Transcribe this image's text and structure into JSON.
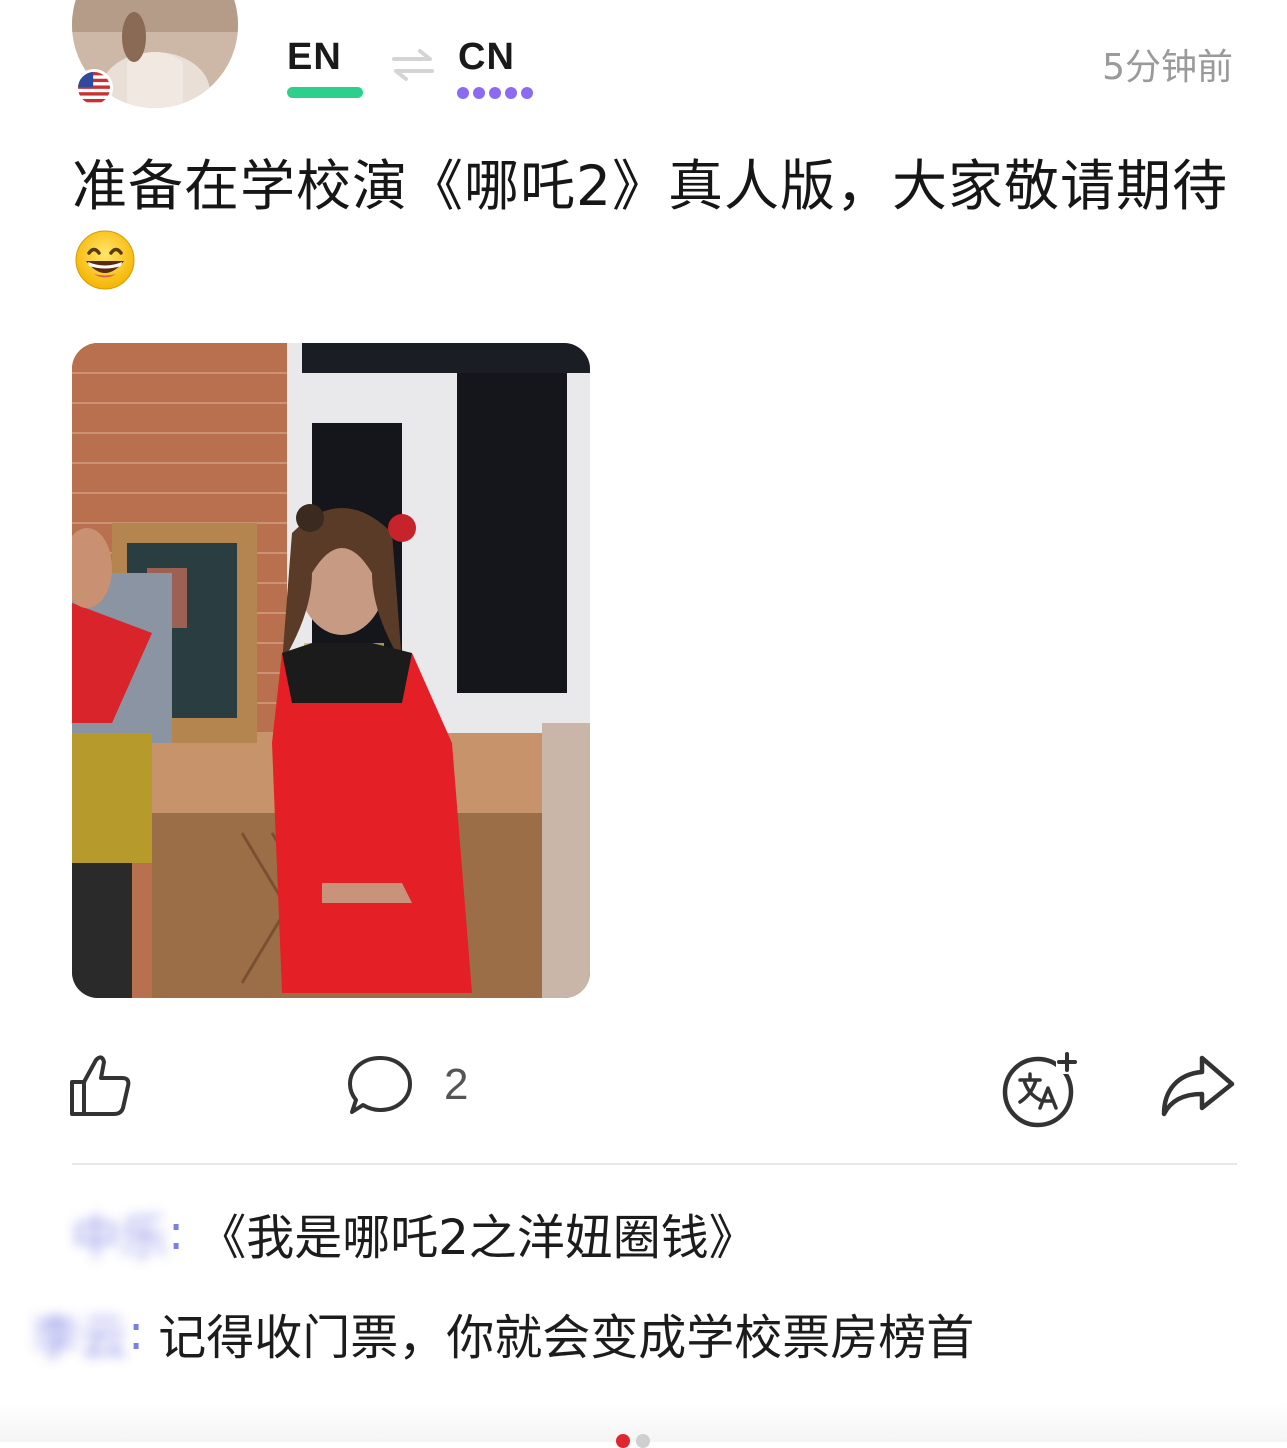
{
  "header": {
    "source_language": "EN",
    "target_language": "CN",
    "timestamp": "5分钟前",
    "accent_green": "#2ccf8c",
    "accent_purple": "#8b6cf0",
    "flag_icon": "us-flag-icon",
    "swap_icon": "swap-arrows-icon"
  },
  "post": {
    "text": "准备在学校演《哪吒2》真人版，大家敬请期待",
    "emoji": "grinning-face-emoji"
  },
  "actions": {
    "like_icon": "thumbs-up-icon",
    "comment_icon": "comment-bubble-icon",
    "comment_count": "2",
    "translate_icon": "translate-icon",
    "share_icon": "share-arrow-icon"
  },
  "comments": [
    {
      "author": "中乐",
      "colon": ":",
      "text": "《我是哪吒2之洋妞圈钱》"
    },
    {
      "author": "李云",
      "colon": ":",
      "text": "记得收门票，你就会变成学校票房榜首"
    }
  ],
  "pagination": {
    "active_color": "#e0262e"
  }
}
